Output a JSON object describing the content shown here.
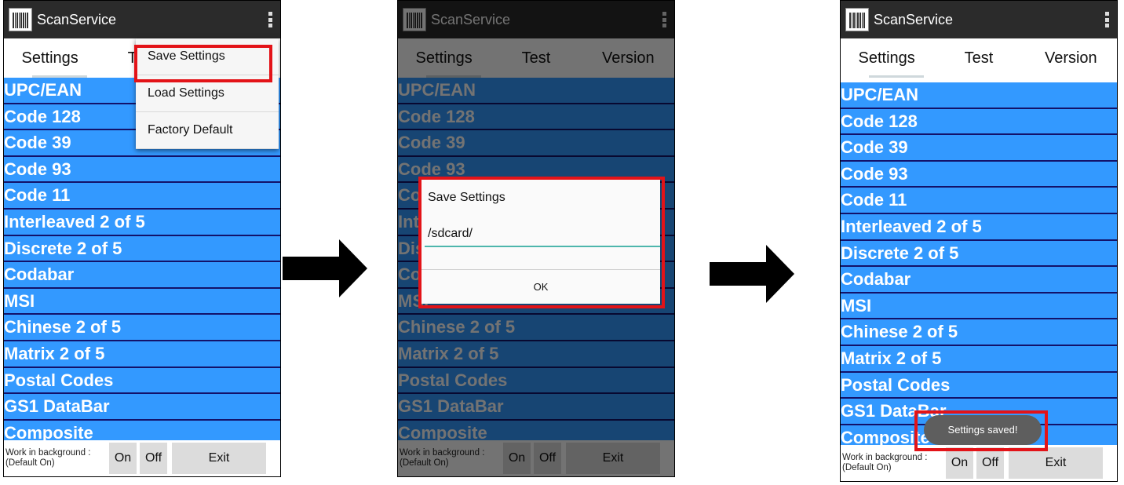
{
  "app_title": "ScanService",
  "tabs": [
    "Settings",
    "Test",
    "Version"
  ],
  "symbologies": [
    "UPC/EAN",
    "Code 128",
    "Code 39",
    "Code 93",
    "Code 11",
    "Interleaved 2 of 5",
    "Discrete 2 of 5",
    "Codabar",
    "MSI",
    "Chinese 2 of 5",
    "Matrix 2 of 5",
    "Postal Codes",
    "GS1 DataBar",
    "Composite"
  ],
  "bottom": {
    "work_line1": "Work in background :",
    "work_line2": "(Default On)",
    "on": "On",
    "off": "Off",
    "exit": "Exit"
  },
  "menu": [
    "Save Settings",
    "Load Settings",
    "Factory Default"
  ],
  "dialog": {
    "title": "Save Settings",
    "path": "/sdcard/",
    "ok": "OK"
  },
  "toast": "Settings saved!",
  "colors": {
    "list_blue": "#3399ff",
    "row_border": "#13126a",
    "highlight_red": "#e31318",
    "appbar": "#2b2b2b"
  }
}
